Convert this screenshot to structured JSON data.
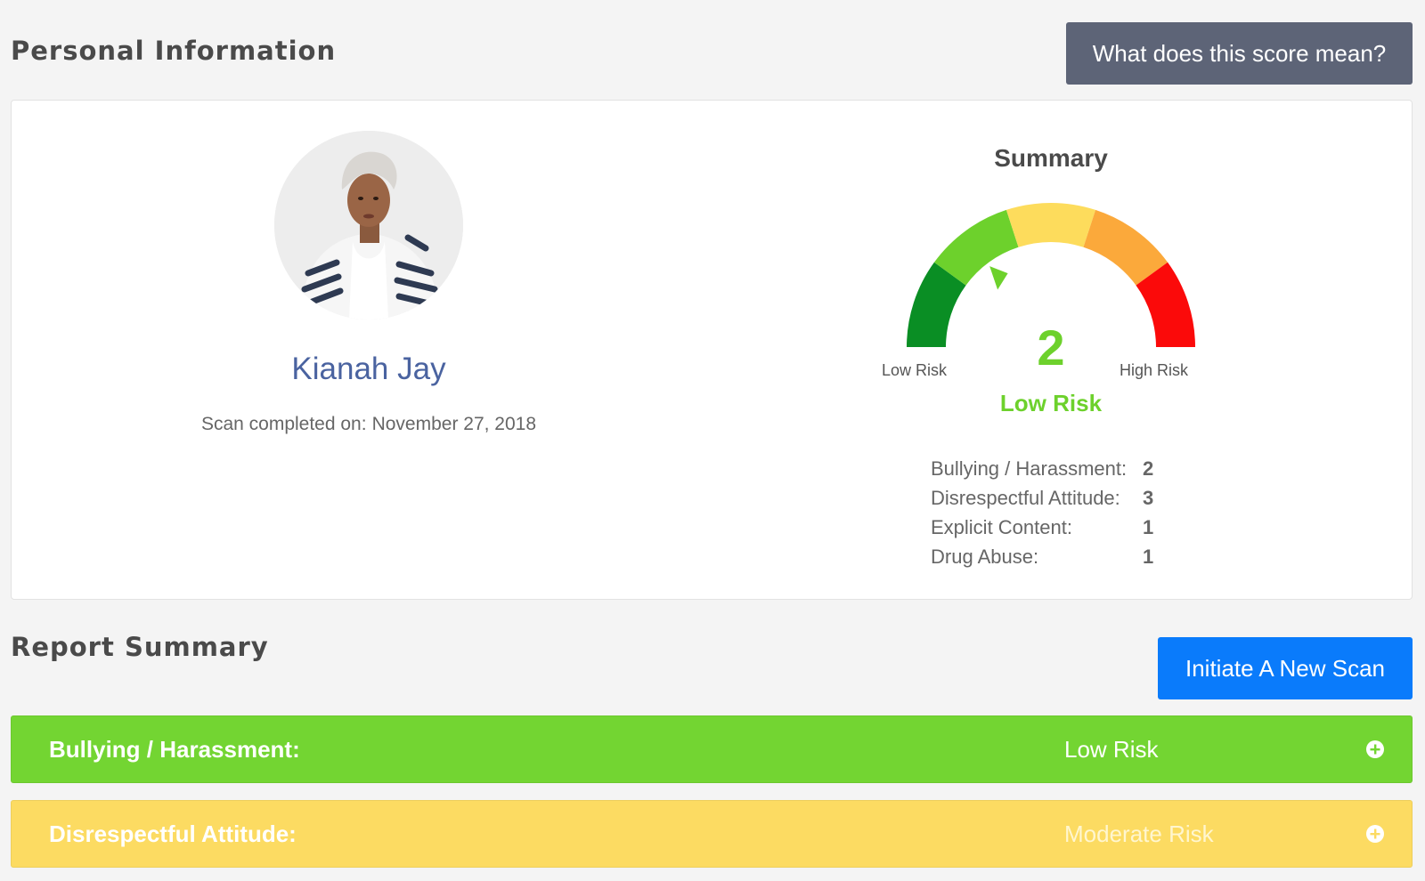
{
  "personal": {
    "title": "Personal Information",
    "score_button": "What does this score mean?",
    "name": "Kianah Jay",
    "scan_label": "Scan completed on:",
    "scan_date": "November 27, 2018"
  },
  "summary": {
    "title": "Summary",
    "gauge": {
      "score": "2",
      "risk_label": "Low Risk",
      "low_label": "Low Risk",
      "high_label": "High Risk",
      "segments": [
        "#0a8e24",
        "#6dd12c",
        "#fddc5c",
        "#fba93b",
        "#fb0a0a"
      ],
      "needle_segment": 1
    },
    "breakdown": [
      {
        "label": "Bullying / Harassment:",
        "value": "2"
      },
      {
        "label": "Disrespectful Attitude:",
        "value": "3"
      },
      {
        "label": "Explicit Content:",
        "value": "1"
      },
      {
        "label": "Drug Abuse:",
        "value": "1"
      }
    ]
  },
  "report": {
    "title": "Report Summary",
    "new_scan_button": "Initiate A New Scan",
    "items": [
      {
        "category": "Bullying / Harassment:",
        "level": "Low Risk",
        "color": "#73d532",
        "icon": "plus-circle-icon"
      },
      {
        "category": "Disrespectful Attitude:",
        "level": "Moderate Risk",
        "color": "#fcdb62",
        "icon": "plus-circle-icon"
      }
    ]
  }
}
